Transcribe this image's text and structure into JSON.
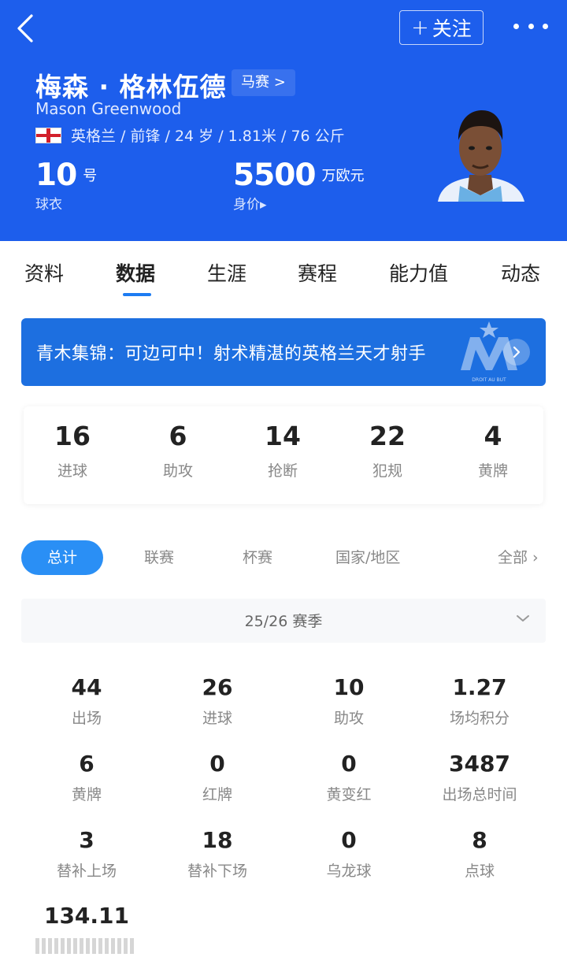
{
  "header": {
    "follow_label": "关注",
    "player": {
      "name_cn": "梅森 · 格林伍德",
      "name_en": "Mason Greenwood",
      "club_link": "马赛 >",
      "meta": "英格兰 / 前锋 / 24 岁 / 1.81米 / 76 公斤",
      "shirt_number": "10",
      "shirt_unit": "号",
      "shirt_label": "球衣",
      "market_value": "5500",
      "market_value_unit": "万欧元",
      "market_value_label": "身价▸"
    },
    "colors": {
      "background": "#1d5eec",
      "flag_red": "#d21f2b"
    }
  },
  "tabs": [
    {
      "label": "资料",
      "active": false
    },
    {
      "label": "数据",
      "active": true
    },
    {
      "label": "生涯",
      "active": false
    },
    {
      "label": "赛程",
      "active": false
    },
    {
      "label": "能力值",
      "active": false
    },
    {
      "label": "动态",
      "active": false
    }
  ],
  "banner": {
    "text": "青木集锦：可边可中！射术精湛的英格兰天才射手",
    "logo_text": "DROIT AU BUT",
    "icon": "chevron-right-icon"
  },
  "summary": [
    {
      "value": "16",
      "label": "进球"
    },
    {
      "value": "6",
      "label": "助攻"
    },
    {
      "value": "14",
      "label": "抢断"
    },
    {
      "value": "22",
      "label": "犯规"
    },
    {
      "value": "4",
      "label": "黄牌"
    }
  ],
  "filters": {
    "items": [
      "总计",
      "联赛",
      "杯赛",
      "国家/地区"
    ],
    "active": "总计",
    "all_label": "全部 ›"
  },
  "season": {
    "label": "25/26 赛季",
    "icon": "chevron-down-icon"
  },
  "stats": [
    {
      "value": "44",
      "label": "出场"
    },
    {
      "value": "26",
      "label": "进球"
    },
    {
      "value": "10",
      "label": "助攻"
    },
    {
      "value": "1.27",
      "label": "场均积分"
    },
    {
      "value": "6",
      "label": "黄牌"
    },
    {
      "value": "0",
      "label": "红牌"
    },
    {
      "value": "0",
      "label": "黄变红"
    },
    {
      "value": "3487",
      "label": "出场总时间"
    },
    {
      "value": "3",
      "label": "替补上场"
    },
    {
      "value": "18",
      "label": "替补下场"
    },
    {
      "value": "0",
      "label": "乌龙球"
    },
    {
      "value": "8",
      "label": "点球"
    },
    {
      "value": "134.11",
      "label": ""
    }
  ],
  "accent_color": "#2a8ff5"
}
